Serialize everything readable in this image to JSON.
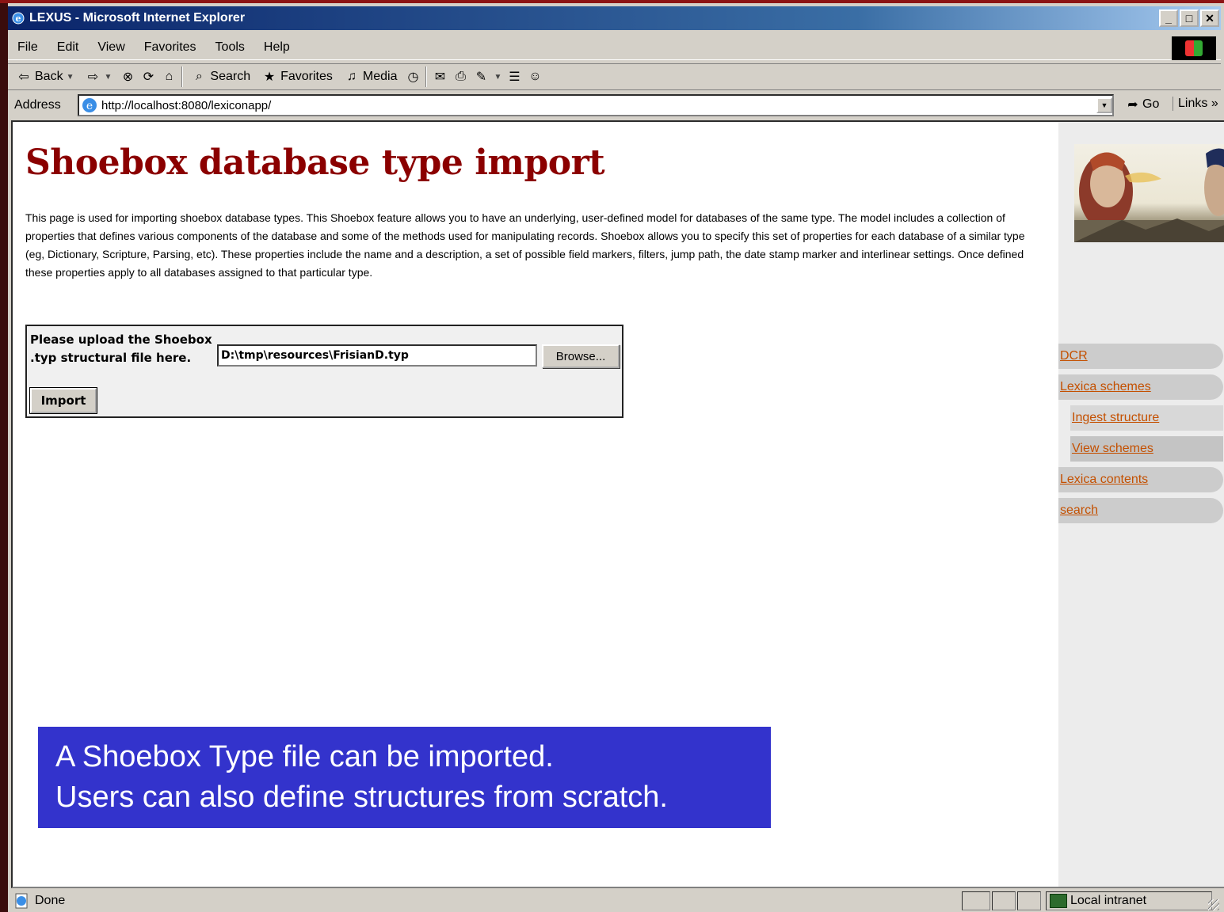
{
  "window": {
    "title": "LEXUS - Microsoft Internet Explorer"
  },
  "menubar": {
    "items": [
      "File",
      "Edit",
      "View",
      "Favorites",
      "Tools",
      "Help"
    ]
  },
  "toolbar": {
    "back_label": "Back",
    "search_label": "Search",
    "favorites_label": "Favorites",
    "media_label": "Media"
  },
  "addressbar": {
    "label": "Address",
    "url": "http://localhost:8080/lexiconapp/",
    "go_label": "Go",
    "links_label": "Links"
  },
  "page": {
    "title": "Shoebox database type import",
    "description": "This page is used for importing shoebox database types. This Shoebox feature allows you to have an underlying, user-defined model for databases of the same type. The model includes a collection of properties that defines various components of the database and some of the methods used for manipulating records. Shoebox allows you to specify this set of properties for each database of a similar type (eg, Dictionary, Scripture, Parsing, etc). These properties include the name and a description, a set of possible field markers, filters, jump path, the date stamp marker and interlinear settings. Once defined these properties apply to all databases assigned to that particular type.",
    "upload": {
      "label": "Please upload the Shoebox .typ structural file here.",
      "file_value": "D:\\tmp\\resources\\FrisianD.typ",
      "browse_label": "Browse...",
      "import_label": "Import"
    }
  },
  "sidebar": {
    "items": [
      {
        "label": "DCR",
        "level": 0
      },
      {
        "label": "Lexica schemes",
        "level": 0
      },
      {
        "label": "Ingest structure",
        "level": 1
      },
      {
        "label": "View schemes",
        "level": 1
      },
      {
        "label": "Lexica contents",
        "level": 0
      },
      {
        "label": "search",
        "level": 0
      }
    ]
  },
  "caption": {
    "line1": "A Shoebox Type file can be imported.",
    "line2": "Users can also define structures from scratch."
  },
  "statusbar": {
    "status": "Done",
    "zone": "Local intranet"
  }
}
